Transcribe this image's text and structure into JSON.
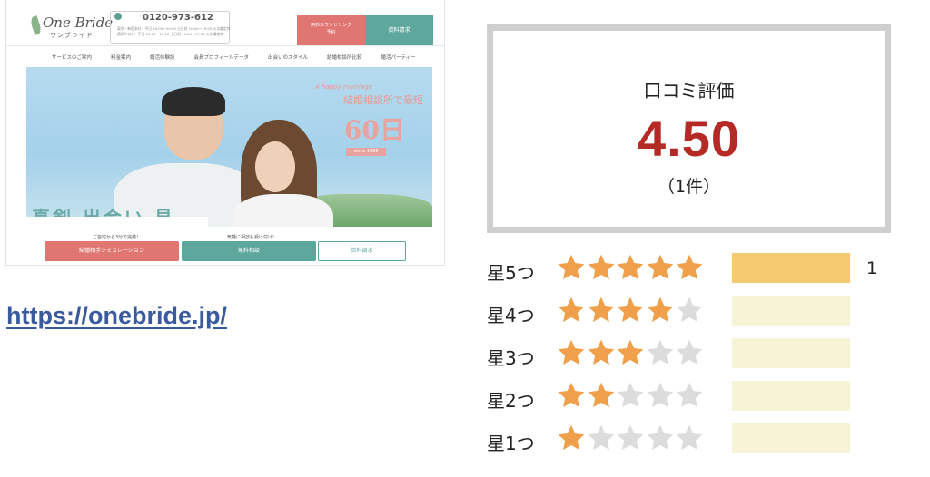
{
  "site_thumbnail": {
    "logo": "One Bride",
    "logo_sub": "ワンブライド",
    "phone": "0120-973-612",
    "hours": "東京・新宿本社：平日 10:00〜20:00 土日祝 10:00〜19:00 火水曜定休\n横浜サロン：平日 10:00〜19:00 土日祝 10:00〜19:00 火水曜定休",
    "counsel_button": "無料カウンセリング\n予約",
    "request_button": "資料請求",
    "nav": [
      "サービスのご案内",
      "料金案内",
      "婚活体験談",
      "会員プロフィールデータ",
      "出会いのスタイル",
      "結婚相談所比較",
      "婚活パーティー"
    ],
    "hero_script": "A happy marriage",
    "hero_tagline": "結婚相談所で最短",
    "hero_number": "60日",
    "hero_since": "since 1966",
    "hero_text": "真剣 出会い 見",
    "sub_left": "ご自宅から3分で完結!",
    "sub_right": "気軽に相談も受け付け!",
    "button_simulation": "結婚相手シミュレーション",
    "button_consult": "無料相談",
    "button_request": "資料請求"
  },
  "url": "https://onebride.jp/",
  "rating": {
    "label": "口コミ評価",
    "score": "4.50",
    "count_text": "（1件）"
  },
  "breakdown": [
    {
      "label": "星5つ",
      "stars": 5,
      "count": "1",
      "fraction": 1.0
    },
    {
      "label": "星4つ",
      "stars": 4,
      "count": "",
      "fraction": 0
    },
    {
      "label": "星3つ",
      "stars": 3,
      "count": "",
      "fraction": 0
    },
    {
      "label": "星2つ",
      "stars": 2,
      "count": "",
      "fraction": 0
    },
    {
      "label": "星1つ",
      "stars": 1,
      "count": "",
      "fraction": 0
    }
  ],
  "colors": {
    "star_filled": "#f0a04b",
    "star_empty": "#dcdcdc",
    "score": "#b52a24",
    "bar_fill": "#f5c970",
    "bar_track": "#f7f3d6",
    "link": "#3a5a9f"
  },
  "icons": {
    "filled": "star-filled-icon",
    "empty": "star-empty-icon"
  }
}
